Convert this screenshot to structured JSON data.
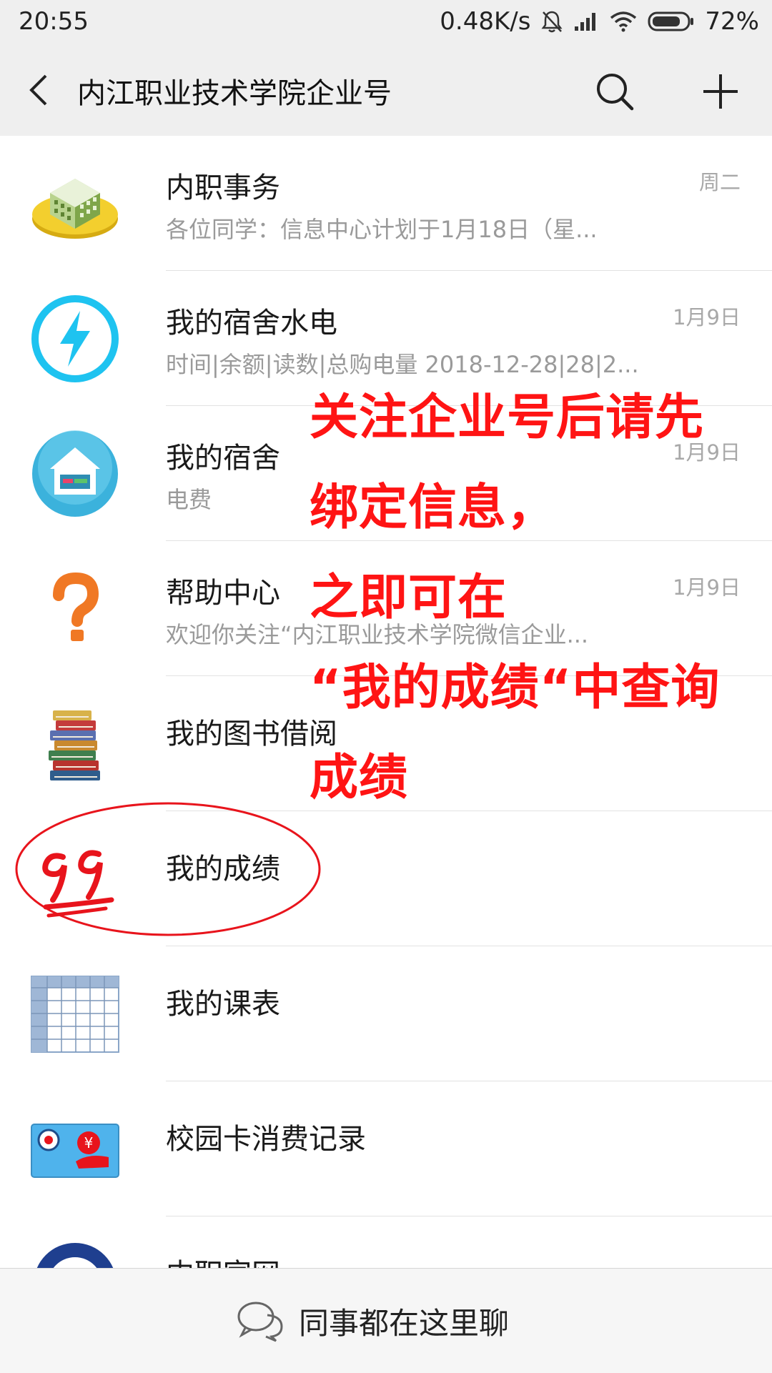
{
  "status_bar": {
    "time": "20:55",
    "network_speed": "0.48K/s",
    "battery_percent": "72%",
    "icons": [
      "mute-bell-icon",
      "signal-icon",
      "wifi-icon",
      "battery-icon"
    ]
  },
  "nav": {
    "title": "内江职业技术学院企业号",
    "icons": [
      "back-arrow-icon",
      "search-icon",
      "plus-icon"
    ]
  },
  "list": {
    "items": [
      {
        "name": "内职事务",
        "preview": "各位同学：信息中心计划于1月18日（星...",
        "date": "周二",
        "icon": "building-icon"
      },
      {
        "name": "我的宿舍水电",
        "preview": "时间|余额|读数|总购电量 2018-12-28|28|2...",
        "date": "1月9日",
        "icon": "lightning-icon"
      },
      {
        "name": "我的宿舍",
        "preview": "电费",
        "date": "1月9日",
        "icon": "house-bed-icon"
      },
      {
        "name": "帮助中心",
        "preview": "欢迎你关注“内江职业技术学院微信企业...",
        "date": "1月9日",
        "icon": "question-mark-icon"
      },
      {
        "name": "我的图书借阅",
        "preview": "",
        "date": "",
        "icon": "book-stack-icon"
      },
      {
        "name": "我的成绩",
        "preview": "",
        "date": "",
        "icon": "hundred-points-icon"
      },
      {
        "name": "我的课表",
        "preview": "",
        "date": "",
        "icon": "timetable-icon"
      },
      {
        "name": "校园卡消费记录",
        "preview": "",
        "date": "",
        "icon": "campus-card-icon"
      },
      {
        "name": "内职官网",
        "preview": "",
        "date": "",
        "icon": "school-emblem-icon"
      }
    ]
  },
  "annotation": {
    "lines": [
      "关注企业号后请先",
      "绑定信息，",
      "之即可在",
      "“我的成绩“中查询",
      "成绩"
    ],
    "color": "#ff1414"
  },
  "bottom_bar": {
    "label": "同事都在这里聊",
    "icon": "chat-bubbles-icon"
  },
  "colors": {
    "header_bg": "#efefef",
    "annotation_red": "#ff1414",
    "secondary_text": "#9a9a9a"
  }
}
